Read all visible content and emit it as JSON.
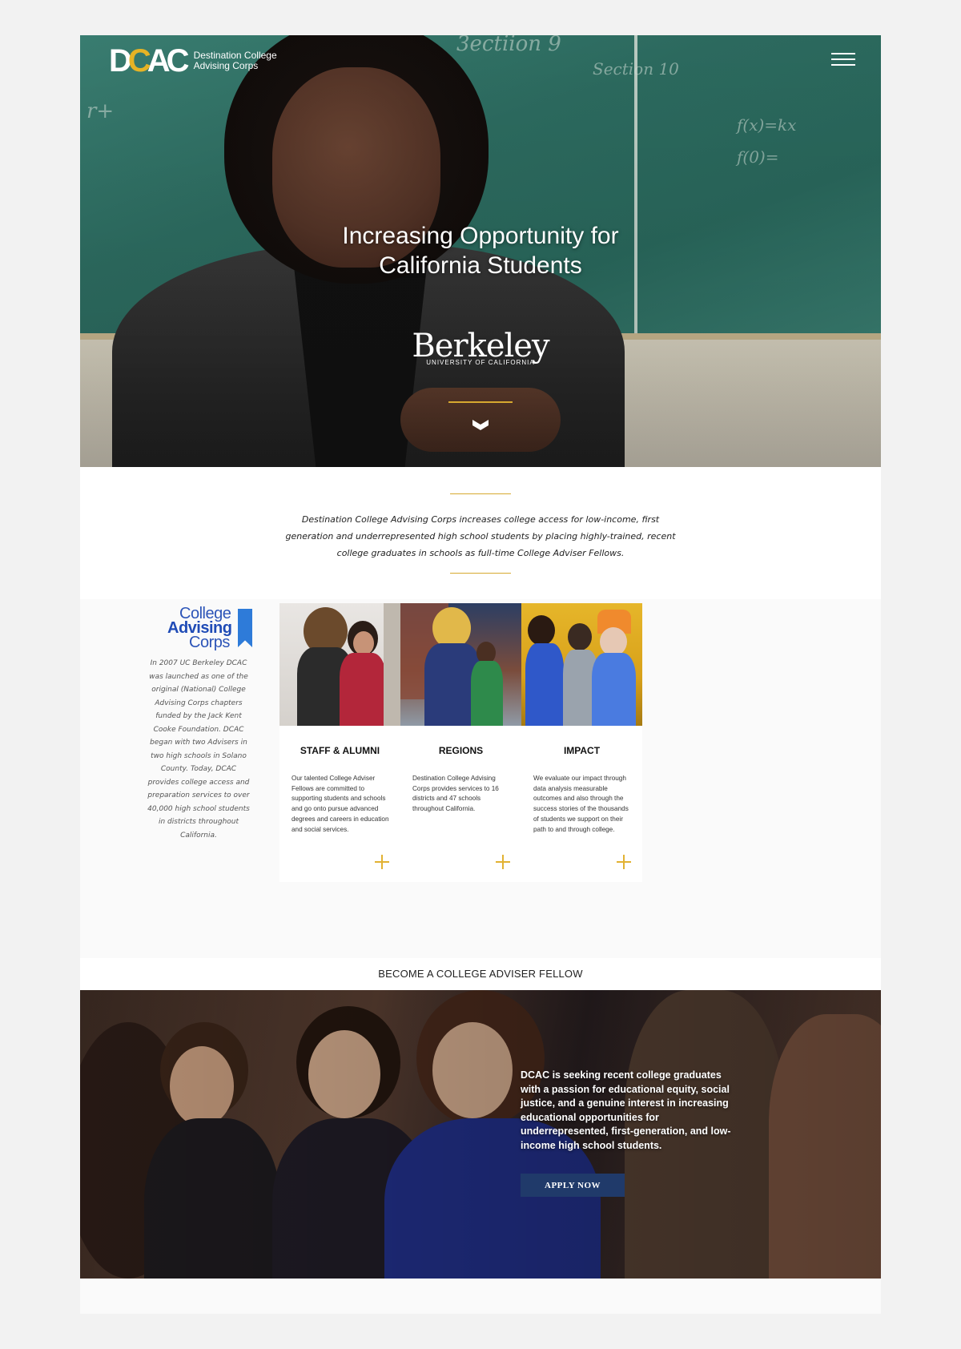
{
  "header": {
    "logo_mark": "DCAC",
    "logo_line1": "Destination College",
    "logo_line2": "Advising Corps"
  },
  "hero": {
    "title_line1": "Increasing Opportunity for",
    "title_line2": "California Students",
    "partner_name": "Berkeley",
    "partner_sub": "UNIVERSITY OF CALIFORNIA"
  },
  "mission": {
    "text": "Destination College Advising Corps increases college access for low-income, first generation and underrepresented high school students by placing highly-trained, recent college graduates in schools as full-time College Adviser Fellows."
  },
  "about": {
    "logo_line1": "College",
    "logo_line2": "Advising",
    "logo_line3": "Corps",
    "text": "In 2007 UC Berkeley DCAC was launched as one of the original (National) College Advising Corps chapters funded by the Jack Kent Cooke Foundation. DCAC began with two Advisers in two high schools in Solano County. Today, DCAC provides college access and preparation services to over 40,000 high school students in districts throughout California."
  },
  "cards": [
    {
      "title": "STAFF & ALUMNI",
      "desc": "Our talented College Adviser Fellows are committed to supporting students and schools and go onto pursue advanced degrees and careers in education and social services."
    },
    {
      "title": "REGIONS",
      "desc": "Destination College Advising Corps provides services to 16 districts and 47 schools throughout California."
    },
    {
      "title": "IMPACT",
      "desc": "We evaluate our impact through data analysis measurable outcomes and also through the success stories of the thousands of students we support on their path to and through college."
    }
  ],
  "fellow": {
    "heading": "BECOME A COLLEGE ADVISER FELLOW",
    "text": "DCAC is seeking recent college graduates with a passion for educational equity, social justice, and a genuine interest in increasing educational opportunities for underrepresented, first-generation, and low-income high school students.",
    "button": "APPLY NOW"
  },
  "colors": {
    "gold": "#d7a92f",
    "navy_button": "#203a6a",
    "cac_blue": "#2d55b8"
  },
  "icons": [
    "menu-icon",
    "chevron-down-icon",
    "plus-icon"
  ]
}
